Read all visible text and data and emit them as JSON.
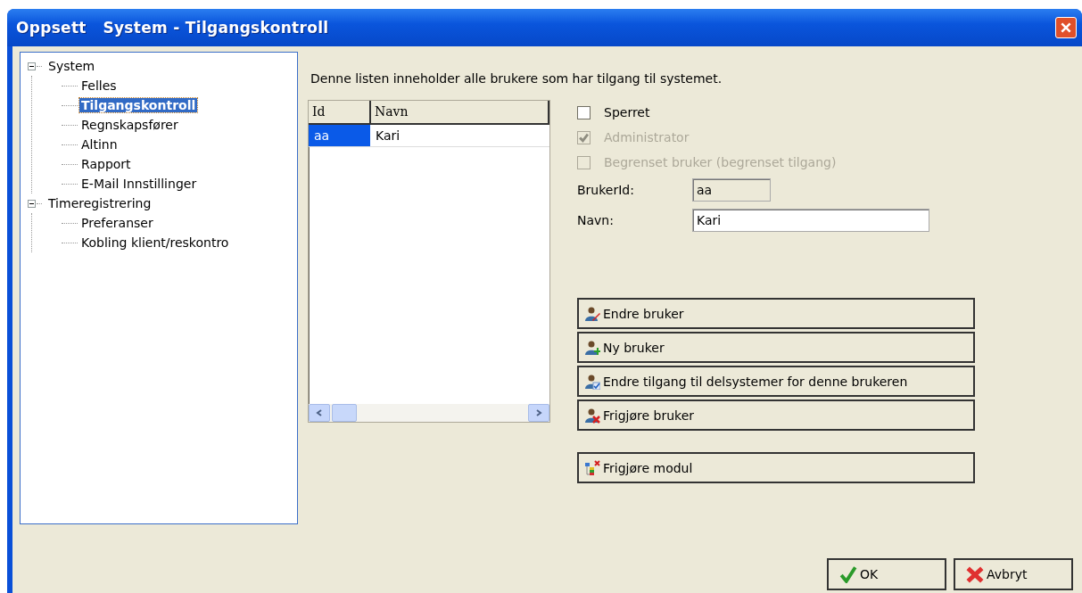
{
  "window": {
    "title": "Oppsett   System - Tilgangskontroll"
  },
  "tree": [
    {
      "label": "System",
      "expanded": true,
      "selected": false,
      "children": [
        {
          "label": "Felles",
          "selected": false
        },
        {
          "label": "Tilgangskontroll",
          "selected": true
        },
        {
          "label": "Regnskapsfører",
          "selected": false
        },
        {
          "label": "Altinn",
          "selected": false
        },
        {
          "label": "Rapport",
          "selected": false
        },
        {
          "label": "E-Mail Innstillinger",
          "selected": false
        }
      ]
    },
    {
      "label": "Timeregistrering",
      "expanded": true,
      "selected": false,
      "children": [
        {
          "label": "Preferanser",
          "selected": false
        },
        {
          "label": "Kobling klient/reskontro",
          "selected": false
        }
      ]
    }
  ],
  "description": "Denne listen inneholder alle brukere som har tilgang til systemet.",
  "table": {
    "columns": [
      "Id",
      "Navn"
    ],
    "rows": [
      {
        "cells": [
          "aa",
          "Kari"
        ],
        "selected": true
      }
    ]
  },
  "checkboxes": [
    {
      "label": "Sperret",
      "checked": false,
      "disabled": false
    },
    {
      "label": "Administrator",
      "checked": true,
      "disabled": true
    },
    {
      "label": "Begrenset bruker (begrenset tilgang)",
      "checked": false,
      "disabled": true
    }
  ],
  "fields": [
    {
      "label": "BrukerId:",
      "value": "aa",
      "disabled": true
    },
    {
      "label": "Navn:",
      "value": "Kari",
      "disabled": false
    }
  ],
  "user_buttons": [
    {
      "label": "Endre bruker",
      "kind": "edit"
    },
    {
      "label": "Ny bruker",
      "kind": "add"
    },
    {
      "label": "Endre tilgang til delsystemer for denne brukeren",
      "kind": "access"
    },
    {
      "label": "Frigjøre bruker",
      "kind": "remove"
    }
  ],
  "module_button": {
    "label": "Frigjøre modul"
  },
  "footer_buttons": [
    {
      "label": "OK",
      "kind": "ok"
    },
    {
      "label": "Avbryt",
      "kind": "cancel"
    }
  ]
}
